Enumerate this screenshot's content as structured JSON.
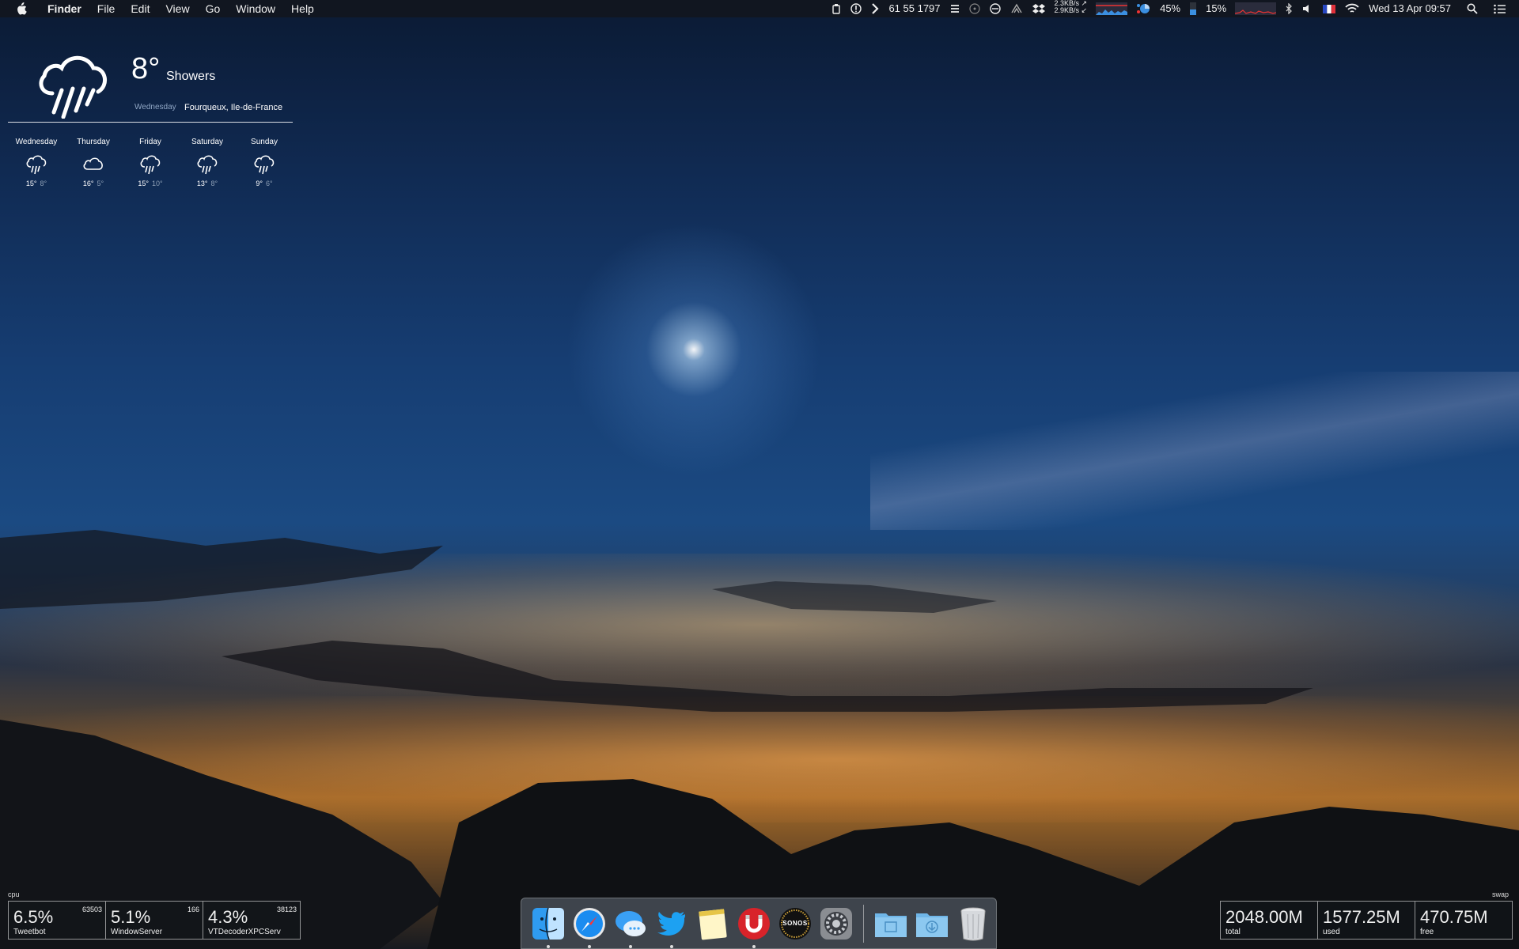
{
  "menubar": {
    "app_name": "Finder",
    "menus": [
      "File",
      "Edit",
      "View",
      "Go",
      "Window",
      "Help"
    ],
    "status_numbers": "61 55 1797",
    "net_up": "2.3KB/s ↗",
    "net_down": "2.9KB/s ↙",
    "battery_percent": "45%",
    "cpu_percent": "15%",
    "datetime": "Wed 13 Apr  09:57"
  },
  "weather": {
    "temperature": "8°",
    "condition": "Showers",
    "day": "Wednesday",
    "location": "Fourqueux, Ile-de-France",
    "forecast": [
      {
        "day": "Wednesday",
        "icon": "rain-icon",
        "high": "15°",
        "low": "8°"
      },
      {
        "day": "Thursday",
        "icon": "cloud-icon",
        "high": "16°",
        "low": "5°"
      },
      {
        "day": "Friday",
        "icon": "rain-icon",
        "high": "15°",
        "low": "10°"
      },
      {
        "day": "Saturday",
        "icon": "rain-icon",
        "high": "13°",
        "low": "8°"
      },
      {
        "day": "Sunday",
        "icon": "rain-icon",
        "high": "9°",
        "low": "6°"
      }
    ]
  },
  "cpu_monitor": {
    "label": "cpu",
    "processes": [
      {
        "percent": "6.5%",
        "name": "Tweetbot",
        "pid": "63503"
      },
      {
        "percent": "5.1%",
        "name": "WindowServer",
        "pid": "166"
      },
      {
        "percent": "4.3%",
        "name": "VTDecoderXPCServ",
        "pid": "38123"
      }
    ]
  },
  "swap_monitor": {
    "label": "swap",
    "stats": [
      {
        "value": "2048.00M",
        "name": "total"
      },
      {
        "value": "1577.25M",
        "name": "used"
      },
      {
        "value": "470.75M",
        "name": "free"
      }
    ]
  },
  "dock": {
    "apps": [
      {
        "name": "finder-icon",
        "running": true
      },
      {
        "name": "safari-icon",
        "running": true
      },
      {
        "name": "messages-icon",
        "running": true
      },
      {
        "name": "twitter-icon",
        "running": true
      },
      {
        "name": "notes-icon",
        "running": false
      },
      {
        "name": "magnet-icon",
        "running": true
      },
      {
        "name": "sonos-icon",
        "running": false
      },
      {
        "name": "system-preferences-icon",
        "running": false
      }
    ],
    "sonos_label": "SONOS",
    "stacks": [
      "movies-folder-icon",
      "downloads-folder-icon",
      "trash-icon"
    ]
  }
}
